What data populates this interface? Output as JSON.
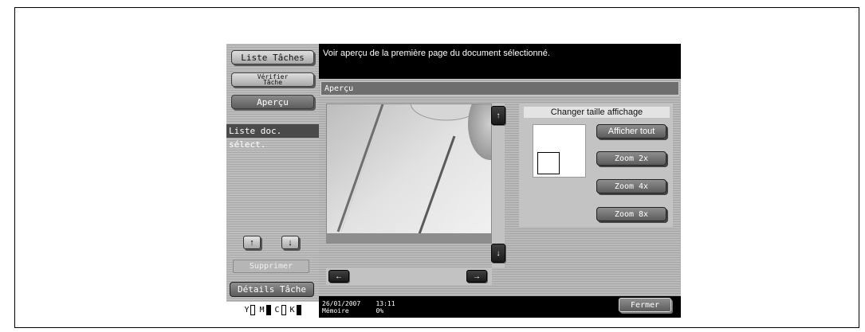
{
  "sidebar": {
    "liste_taches": "Liste Tâches",
    "verifier_line1": "Vérifier",
    "verifier_line2": "Tâche",
    "apercu": "Aperçu",
    "liste_doc": "Liste doc. sélect.",
    "supprimer": "Supprimer",
    "details": "Détails Tâche",
    "up_arrow": "↑",
    "down_arrow": "↓"
  },
  "toner": [
    {
      "label": "Y",
      "level": "low"
    },
    {
      "label": "M",
      "level": "full"
    },
    {
      "label": "C",
      "level": "low"
    },
    {
      "label": "K",
      "level": "full"
    }
  ],
  "message": "Voir aperçu de la première page du document sélectionné.",
  "panel": {
    "title": "Aperçu"
  },
  "scroll": {
    "up": "↑",
    "down": "↓",
    "left": "←",
    "right": "→"
  },
  "zoom": {
    "title": "Changer taille affichage",
    "afficher_tout": "Afficher tout",
    "zoom2": "Zoom 2x",
    "zoom4": "Zoom 4x",
    "zoom8": "Zoom 8x"
  },
  "footer": {
    "date": "26/01/2007",
    "time": "13:11",
    "memoire_label": "Mémoire",
    "memoire_value": "0%",
    "fermer": "Fermer"
  }
}
